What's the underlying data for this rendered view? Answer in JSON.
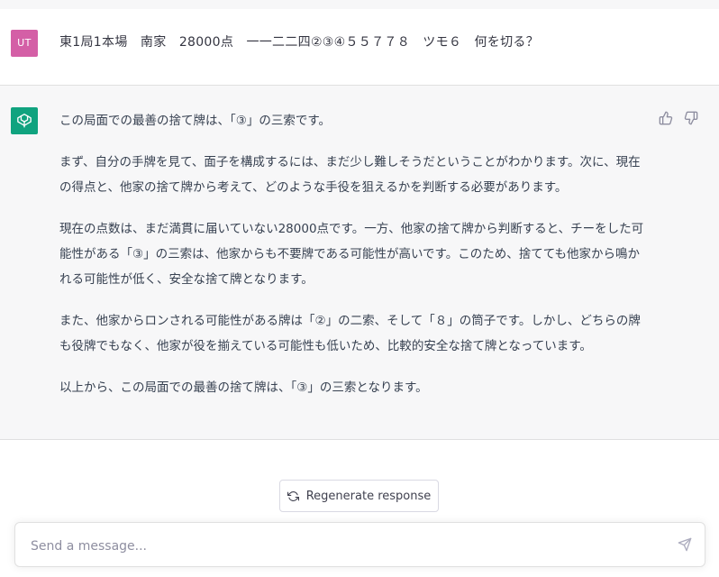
{
  "user_message": {
    "avatar_initials": "UT",
    "text": "東1局1本場　南家　28000点　一一二二四②③④５５７７８　ツモ６　何を切る？"
  },
  "assistant_message": {
    "paragraphs": [
      "この局面での最善の捨て牌は、「③」の三索です。",
      "まず、自分の手牌を見て、面子を構成するには、まだ少し難しそうだということがわかります。次に、現在の得点と、他家の捨て牌から考えて、どのような手役を狙えるかを判断する必要があります。",
      "現在の点数は、まだ満貫に届いていない28000点です。一方、他家の捨て牌から判断すると、チーをした可能性がある「③」の三索は、他家からも不要牌である可能性が高いです。このため、捨てても他家から鳴かれる可能性が低く、安全な捨て牌となります。",
      "また、他家からロンされる可能性がある牌は「②」の二索、そして「８」の筒子です。しかし、どちらの牌も役牌でもなく、他家が役を揃えている可能性も低いため、比較的安全な捨て牌となっています。",
      "以上から、この局面での最善の捨て牌は、「③」の三索となります。"
    ]
  },
  "regenerate": {
    "label": "Regenerate response"
  },
  "composer": {
    "placeholder": "Send a message..."
  },
  "colors": {
    "user_avatar": "#d45fa6",
    "assistant_avatar": "#10a37f",
    "assistant_bg": "#f7f7f8"
  },
  "icons": {
    "assistant": "openai-logo-icon",
    "thumbs_up": "thumbs-up-icon",
    "thumbs_down": "thumbs-down-icon",
    "regenerate": "refresh-icon",
    "send": "send-icon"
  }
}
